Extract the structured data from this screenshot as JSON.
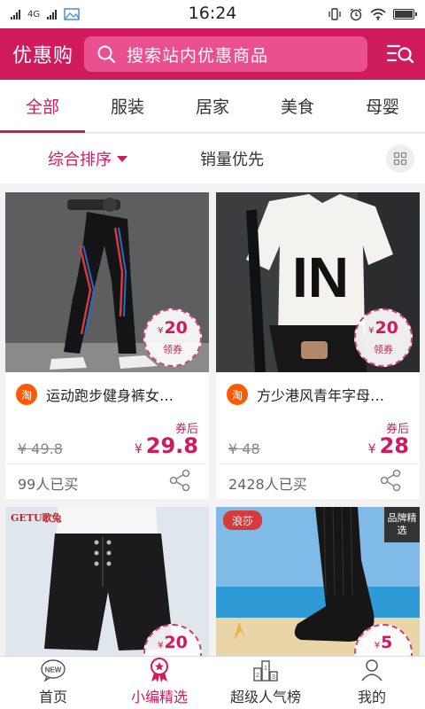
{
  "status_bar": {
    "time": "16:24",
    "network": "4G"
  },
  "header": {
    "brand": "优惠购",
    "search_placeholder": "搜索站内优惠商品"
  },
  "categories": [
    {
      "label": "全部",
      "active": true
    },
    {
      "label": "服装",
      "active": false
    },
    {
      "label": "居家",
      "active": false
    },
    {
      "label": "美食",
      "active": false
    },
    {
      "label": "母婴",
      "active": false
    }
  ],
  "sort": {
    "comprehensive": "综合排序",
    "sales_first": "销量优先"
  },
  "products": [
    {
      "title": "运动跑步健身裤女…",
      "coupon_amount": "20",
      "coupon_label": "领券",
      "source_badge": "淘",
      "after_coupon_label": "券后",
      "original_price": "¥ 49.8",
      "price": "29.8",
      "currency": "¥",
      "sold": "99人已买"
    },
    {
      "title": "方少港风青年字母…",
      "coupon_amount": "20",
      "coupon_label": "领券",
      "source_badge": "淘",
      "after_coupon_label": "券后",
      "original_price": "¥ 48",
      "price": "28",
      "currency": "¥",
      "sold": "2428人已买",
      "shirt_print": "IN"
    },
    {
      "coupon_amount": "20",
      "currency": "¥",
      "logo_text": "GETU歌兔"
    },
    {
      "coupon_amount": "5",
      "currency": "¥",
      "logo_text": "浪莎",
      "brand_badge": "品牌精选"
    }
  ],
  "bottom_nav": [
    {
      "label": "首页",
      "icon": "new-icon",
      "icon_text": "NEW",
      "active": false
    },
    {
      "label": "小编精选",
      "icon": "award-icon",
      "active": true
    },
    {
      "label": "超级人气榜",
      "icon": "podium-icon",
      "active": false,
      "podium": [
        "2",
        "1",
        "3"
      ]
    },
    {
      "label": "我的",
      "icon": "user-icon",
      "active": false
    }
  ],
  "colors": {
    "brand": "#cf1b5c",
    "search_bg": "#e9508d",
    "taobao": "#ff5a00"
  }
}
